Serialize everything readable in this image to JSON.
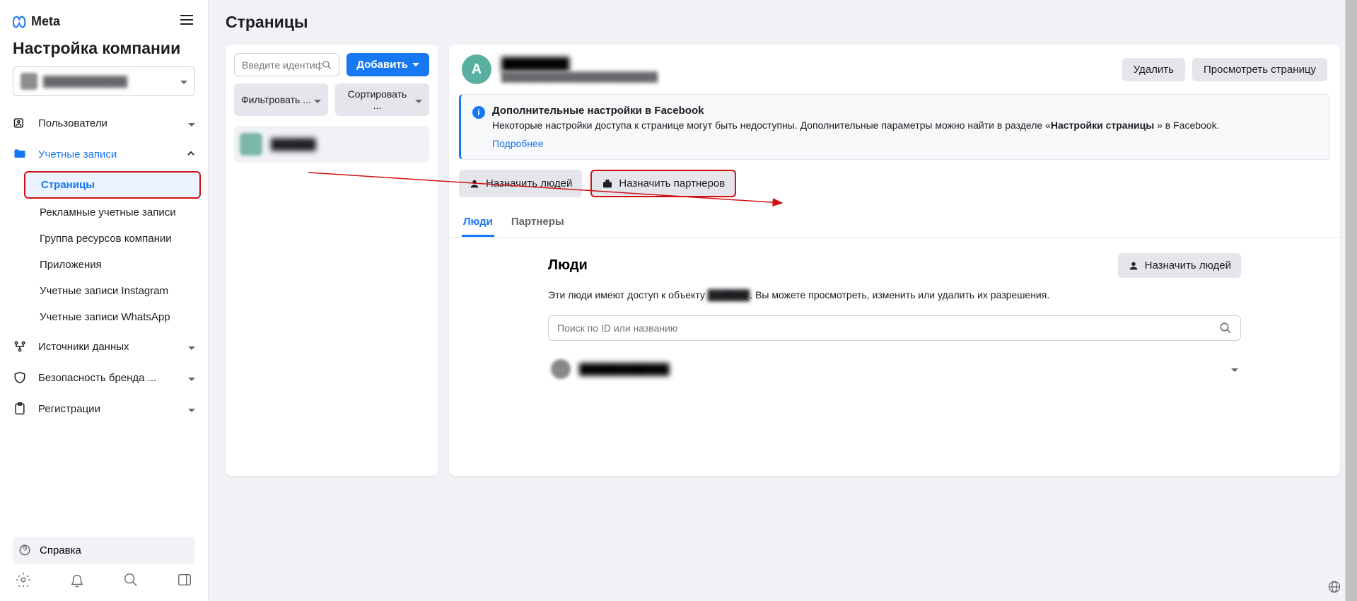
{
  "sidebar": {
    "logo_text": "Meta",
    "title": "Настройка компании",
    "company_name": "████████████",
    "nav": {
      "users": "Пользователи",
      "accounts": "Учетные записи",
      "accounts_children": {
        "pages": "Страницы",
        "ad_accounts": "Рекламные учетные записи",
        "resource_group": "Группа ресурсов компании",
        "apps": "Приложения",
        "instagram": "Учетные записи Instagram",
        "whatsapp": "Учетные записи WhatsApp"
      },
      "data_sources": "Источники данных",
      "brand_safety": "Безопасность бренда ...",
      "registrations": "Регистрации"
    },
    "help": "Справка"
  },
  "main": {
    "title": "Страницы",
    "search_placeholder": "Введите идентиф...",
    "add_button": "Добавить",
    "filter_button": "Фильтровать ...",
    "sort_button": "Сортировать ...",
    "page_item_name": "██████",
    "detail": {
      "avatar_letter": "А",
      "name": "████████",
      "sub": "████████████████████████",
      "delete": "Удалить",
      "view": "Просмотреть страницу",
      "info_title": "Дополнительные настройки в Facebook",
      "info_body_1": "Некоторые настройки доступа к странице могут быть недоступны. Дополнительные параметры можно найти в разделе «",
      "info_body_2": "Настройки страницы",
      "info_body_3": " » в Facebook.",
      "info_link": "Подробнее",
      "assign_people": "Назначить людей",
      "assign_partners": "Назначить партнеров",
      "tab_people": "Люди",
      "tab_partners": "Партнеры",
      "people_title": "Люди",
      "people_desc_1": "Эти люди имеют доступ к объекту ",
      "people_desc_blur": "██████",
      "people_desc_2": ". Вы можете просмотреть, изменить или удалить их разрешения.",
      "people_search_placeholder": "Поиск по ID или названию",
      "person_name": "████████████"
    }
  }
}
